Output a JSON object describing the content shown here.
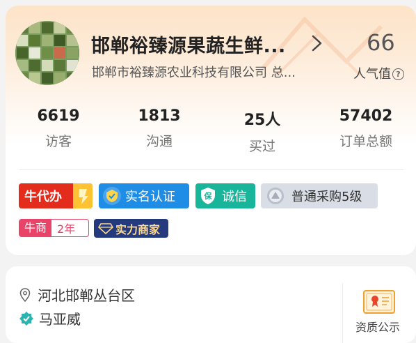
{
  "shop": {
    "name": "邯郸裕臻源果蔬生鲜...",
    "company": "邯郸市裕臻源农业科技有限公司  总...",
    "popularity_value": "66",
    "popularity_label": "人气值"
  },
  "stats": [
    {
      "value": "6619",
      "label": "访客"
    },
    {
      "value": "1813",
      "label": "沟通"
    },
    {
      "value": "25人",
      "label": "买过"
    },
    {
      "value": "57402",
      "label": "订单总额"
    }
  ],
  "badges": {
    "niudaiban": "牛代办",
    "realname": "实名认证",
    "chengxin": "诚信",
    "level": "普通采购5级",
    "niushang": "牛商",
    "niushang_years": "2年",
    "shili": "实力商家"
  },
  "info": {
    "location": "河北邯郸丛台区",
    "person": "马亚威",
    "cert_label": "资质公示"
  },
  "colors": {
    "accent_orange": "#fde3c8",
    "niudaiban_red": "#e32c1c",
    "realname_blue": "#1f8de6",
    "chengxin_teal": "#18b59b",
    "niushang_pink": "#e8446a",
    "shili_navy": "#243a7e",
    "verified_teal": "#2bb5b0"
  },
  "icons": {
    "help": "question-circle-icon",
    "location": "location-pin-icon",
    "verified": "verified-badge-icon",
    "certificate": "certificate-icon",
    "arrow": "chevron-right-icon"
  }
}
